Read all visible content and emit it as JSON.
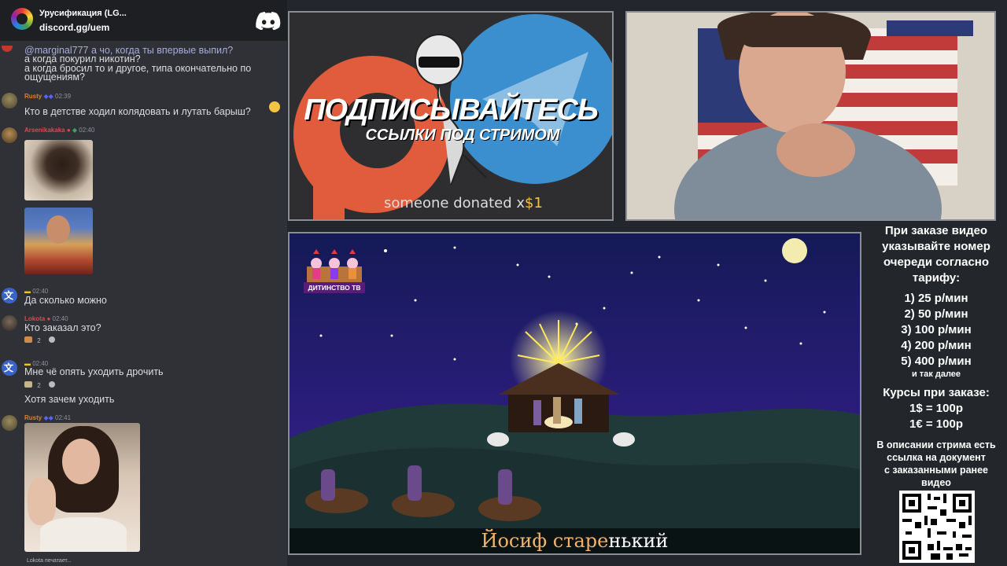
{
  "discord": {
    "server_name": "Урусификация (LG...",
    "invite": "discord.gg/uem",
    "messages": [
      {
        "lines": [
          "@marginal777 а чо, когда ты впервые выпил?",
          "а когда покурил никотин?",
          "а когда бросил то и другое, типа окончательно по",
          "ощущениям?"
        ]
      },
      {
        "user": "Rusty",
        "time": "02:39",
        "text": "Кто в детстве ходил колядовать и лутать барыш?"
      },
      {
        "user": "Arsenikakaka",
        "time": "02:40"
      },
      {
        "user": "",
        "time": "02:40",
        "text": "Да сколько можно"
      },
      {
        "user": "Lokota",
        "time": "02:40",
        "text": "Кто заказал это?",
        "reactions": [
          "2"
        ]
      },
      {
        "user": "",
        "time": "02:40",
        "text": "Мне чё опять уходить дрочить",
        "reactions": [
          "2"
        ]
      },
      {
        "text": "Хотя зачем уходить"
      },
      {
        "user": "Rusty",
        "time": "02:41"
      }
    ],
    "typing_status": "Lokota печатает..."
  },
  "promo": {
    "title": "ПОДПИСЫВАЙТЕСЬ",
    "subtitle": "ССЫЛКИ ПОД СТРИМОМ",
    "donation_text": "someone donated x",
    "donation_amount": "$1"
  },
  "video": {
    "channel_label": "ДИТИНСТВО ТВ",
    "subtitle_sung": "Йосиф старе",
    "subtitle_rest": "нький"
  },
  "info": {
    "heading": [
      "При заказе видео",
      "указывайте номер",
      "очереди согласно",
      "тарифу:"
    ],
    "tariffs": [
      "1) 25 р/мин",
      "2) 50 р/мин",
      "3) 100 р/мин",
      "4) 200 р/мин",
      "5) 400 р/мин"
    ],
    "etc": "и так далее",
    "rates_heading": "Курсы при заказе:",
    "rates": [
      "1$ = 100р",
      "1€ = 100р"
    ],
    "note": [
      "В описании стрима есть",
      "ссылка на документ",
      "с заказанными ранее",
      "видео"
    ]
  },
  "colors": {
    "chat_bg": "#2f3136",
    "username_red": "#e0484f",
    "username_orange": "#e67e22",
    "accent_gold": "#f4b26a"
  }
}
